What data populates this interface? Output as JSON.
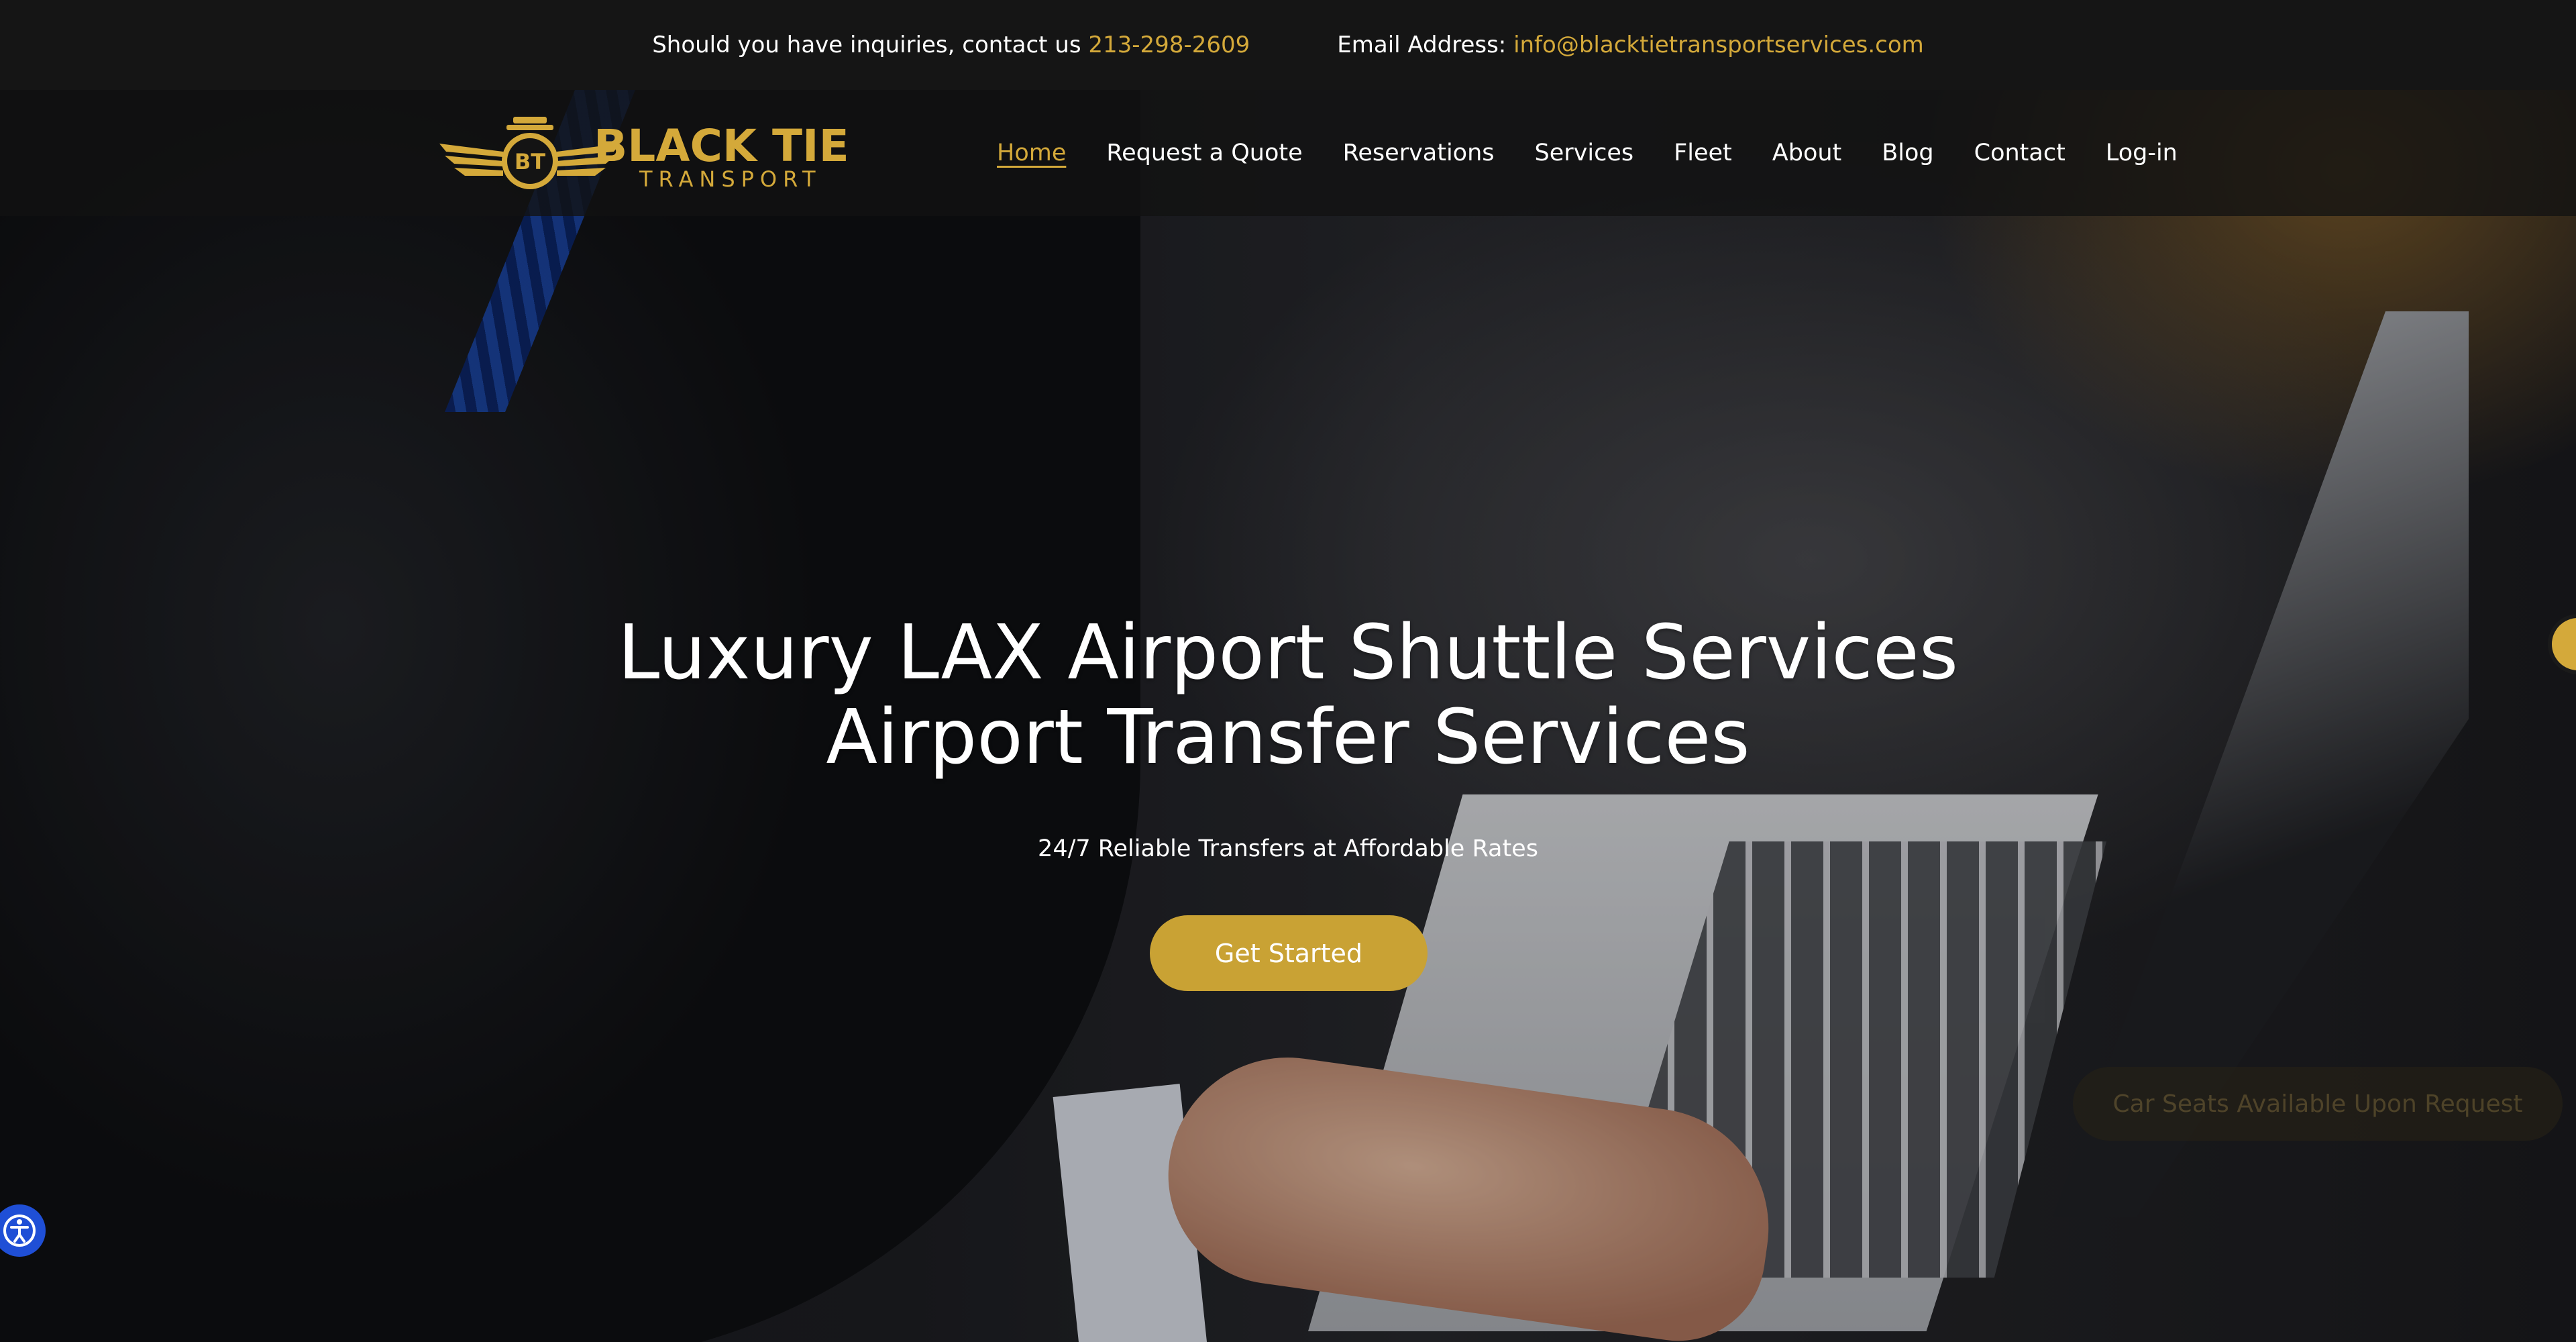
{
  "topbar": {
    "inquiry_label": "Should you have inquiries, contact us",
    "phone": "213-298-2609",
    "email_label": "Email Address:",
    "email": "info@blacktietransportservices.com"
  },
  "logo": {
    "initials": "BT",
    "name": "BLACK TIE",
    "tagline": "TRANSPORT"
  },
  "nav": {
    "items": [
      {
        "label": "Home",
        "active": true
      },
      {
        "label": "Request a Quote"
      },
      {
        "label": "Reservations"
      },
      {
        "label": "Services"
      },
      {
        "label": "Fleet"
      },
      {
        "label": "About"
      },
      {
        "label": "Blog"
      },
      {
        "label": "Contact"
      },
      {
        "label": "Log-in"
      }
    ]
  },
  "hero": {
    "title_line1": "Luxury LAX Airport Shuttle Services",
    "title_line2": "Airport Transfer Services",
    "subtitle": "24/7 Reliable Transfers at Affordable Rates",
    "cta_label": "Get Started",
    "faded_notice": "Car Seats Available Upon Request"
  },
  "colors": {
    "accent": "#d4a93a",
    "button": "#c9a234",
    "topbar_bg": "#151515",
    "accessibility_button": "#1f4fd6"
  },
  "icons": {
    "side_widget": "gold-circle-widget-icon",
    "accessibility": "accessibility-icon"
  }
}
